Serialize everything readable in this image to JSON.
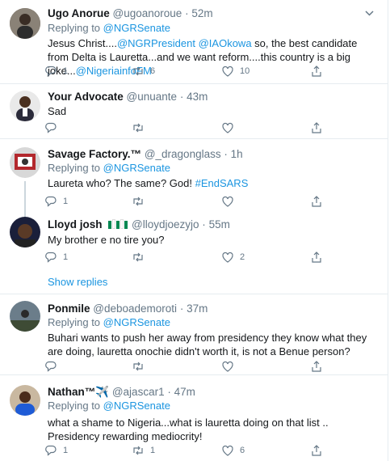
{
  "tweets": [
    {
      "name": "Ugo Anorue",
      "handle": "@ugoanoroue",
      "time": "52m",
      "reply_prefix": "Replying to",
      "reply_to": "@NGRSenate",
      "body_parts": [
        {
          "t": "Jesus Christ....",
          "link": false
        },
        {
          "t": "@NGRPresident",
          "link": true
        },
        {
          "t": " ",
          "link": false
        },
        {
          "t": "@IAOkowa",
          "link": true
        },
        {
          "t": " so, the best candidate from Delta is Lauretta...and we want reform....this country is a big joke...",
          "link": false
        },
        {
          "t": "@NigeriainfoFM",
          "link": true
        }
      ],
      "replies": "1",
      "retweets": "6",
      "likes": "10"
    },
    {
      "name": "Your Advocate",
      "handle": "@unuante",
      "time": "43m",
      "body": "Sad",
      "replies": "",
      "retweets": "",
      "likes": ""
    },
    {
      "name": "Savage Factory.™",
      "handle": "@_dragonglass",
      "time": "1h",
      "reply_prefix": "Replying to",
      "reply_to": "@NGRSenate",
      "body_parts": [
        {
          "t": "Laureta who? The same? God! ",
          "link": false
        },
        {
          "t": "#EndSARS",
          "link": true
        }
      ],
      "replies": "1",
      "retweets": "",
      "likes": ""
    },
    {
      "name": "Lloyd josh",
      "handle": "@lloydjoezyjo",
      "time": "55m",
      "body": "My brother e no tire you?",
      "replies": "1",
      "retweets": "",
      "likes": "2",
      "show_replies": "Show replies"
    },
    {
      "name": "Ponmile",
      "handle": "@deboademoroti",
      "time": "37m",
      "reply_prefix": "Replying to",
      "reply_to": "@NGRSenate",
      "body": "Buhari wants to push her away from presidency they know what they are doing, lauretta onochie didn't worth it, is not a Benue person?",
      "replies": "",
      "retweets": "",
      "likes": ""
    },
    {
      "name": "Nathan™",
      "name_suffix": "✈️",
      "handle": "@ajascar1",
      "time": "47m",
      "reply_prefix": "Replying to",
      "reply_to": "@NGRSenate",
      "body": "what a shame to Nigeria...what is lauretta doing on that list .. Presidency rewarding mediocrity!",
      "replies": "1",
      "retweets": "1",
      "likes": "6"
    }
  ],
  "separator": "·",
  "colors": {
    "link": "#1b95e0",
    "muted": "#657786",
    "flag_green": "#008751"
  },
  "icons": [
    "chevron-down-icon",
    "reply-icon",
    "retweet-icon",
    "like-icon",
    "share-icon"
  ]
}
